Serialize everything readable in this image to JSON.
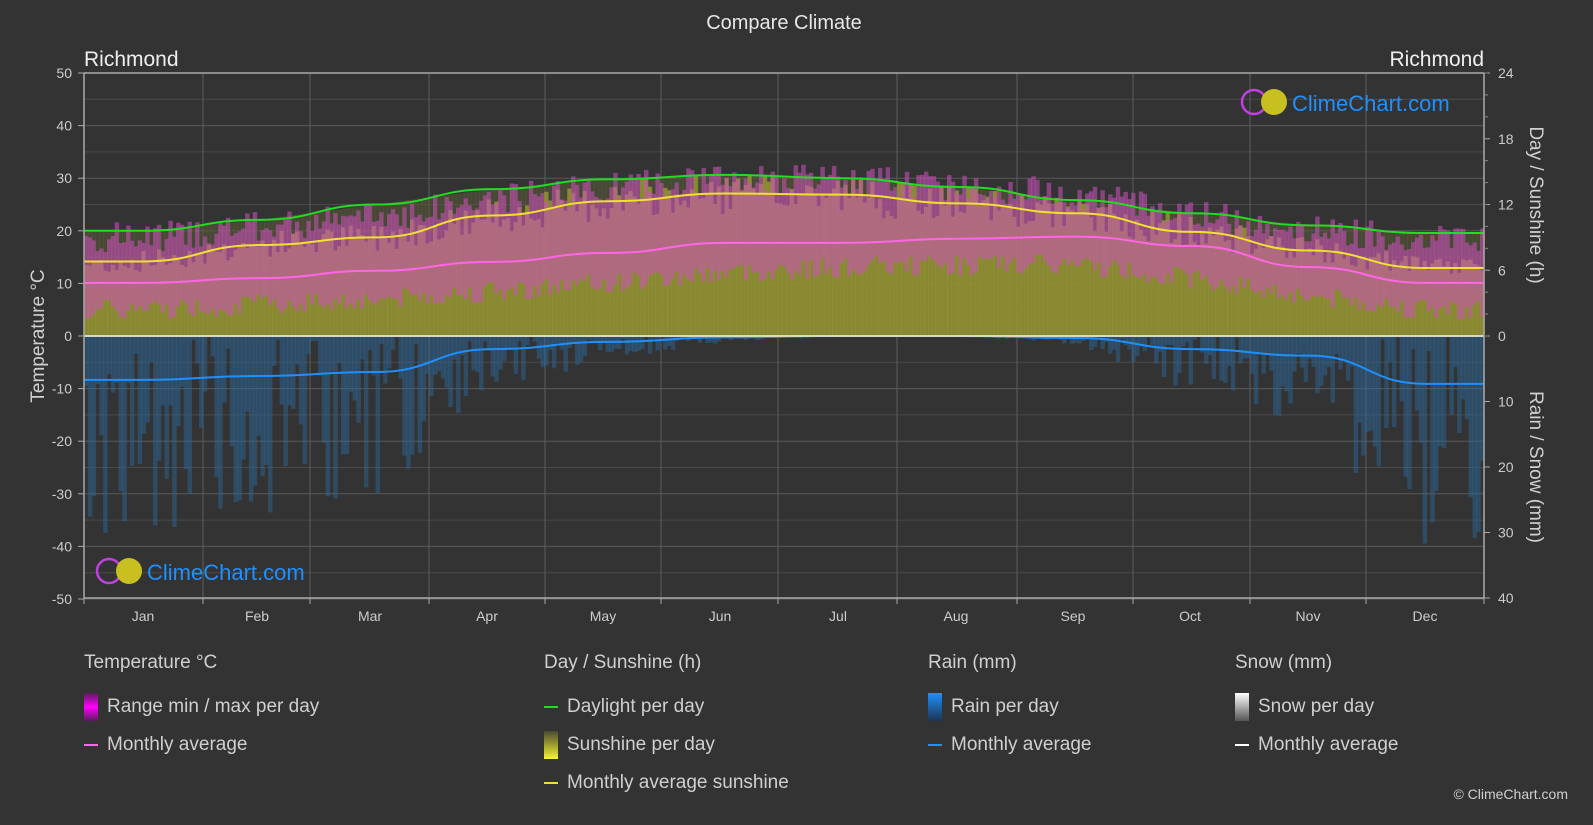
{
  "title": "Compare Climate",
  "location_left": "Richmond",
  "location_right": "Richmond",
  "watermark": "ClimeChart.com",
  "copyright": "© ClimeChart.com",
  "colors": {
    "background": "#333333",
    "temp_range": "#e020e0",
    "temp_avg": "#ff66e6",
    "daylight": "#22dd22",
    "sunshine_fill": "#a8a830",
    "sunshine_avg": "#f0e030",
    "rain": "#2a7abf",
    "rain_avg": "#1e90ff",
    "snow_avg": "#ffffff",
    "logo_blue": "#1e90ff"
  },
  "legend": {
    "temperature": {
      "title": "Temperature °C",
      "items": [
        "Range min / max per day",
        "Monthly average"
      ]
    },
    "sunshine": {
      "title": "Day / Sunshine (h)",
      "items": [
        "Daylight per day",
        "Sunshine per day",
        "Monthly average sunshine"
      ]
    },
    "rain": {
      "title": "Rain (mm)",
      "items": [
        "Rain per day",
        "Monthly average"
      ]
    },
    "snow": {
      "title": "Snow (mm)",
      "items": [
        "Snow per day",
        "Monthly average"
      ]
    }
  },
  "chart_data": {
    "type": "line",
    "title": "Compare Climate",
    "categories": [
      "Jan",
      "Feb",
      "Mar",
      "Apr",
      "May",
      "Jun",
      "Jul",
      "Aug",
      "Sep",
      "Oct",
      "Nov",
      "Dec"
    ],
    "left_axis": {
      "label": "Temperature °C",
      "range": [
        -50,
        50
      ],
      "ticks": [
        50,
        40,
        30,
        20,
        10,
        0,
        -10,
        -20,
        -30,
        -40,
        -50
      ]
    },
    "right_axis_top": {
      "label": "Day / Sunshine (h)",
      "range": [
        0,
        24
      ],
      "ticks": [
        24,
        18,
        12,
        6,
        0
      ]
    },
    "right_axis_bottom": {
      "label": "Rain / Snow (mm)",
      "range": [
        0,
        40
      ],
      "ticks": [
        0,
        10,
        20,
        30,
        40
      ]
    },
    "grid": true,
    "series": [
      {
        "name": "Temperature monthly average",
        "unit": "°C",
        "axis": "temp",
        "values": [
          10.1,
          11.0,
          12.4,
          14.1,
          15.8,
          17.7,
          17.7,
          18.5,
          18.9,
          17.1,
          13.1,
          10.1
        ]
      },
      {
        "name": "Temperature daily max (approx band top)",
        "unit": "°C",
        "axis": "temp",
        "values": [
          17.5,
          19.5,
          21.5,
          24.5,
          27,
          28.5,
          28.5,
          27.5,
          26,
          22,
          19,
          17.5
        ]
      },
      {
        "name": "Temperature daily min (approx band bottom)",
        "unit": "°C",
        "axis": "temp",
        "values": [
          5,
          6,
          7,
          8.5,
          10,
          12,
          13,
          13.5,
          13.5,
          11,
          7.5,
          5
        ]
      },
      {
        "name": "Daylight per day",
        "unit": "h",
        "axis": "sun",
        "values": [
          9.6,
          10.6,
          12.0,
          13.4,
          14.3,
          14.7,
          14.4,
          13.6,
          12.4,
          11.2,
          10.1,
          9.4
        ]
      },
      {
        "name": "Monthly average sunshine",
        "unit": "h",
        "axis": "sun",
        "values": [
          6.8,
          8.3,
          9.0,
          11.0,
          12.3,
          13.0,
          12.9,
          12.1,
          11.2,
          9.5,
          7.8,
          6.2
        ]
      },
      {
        "name": "Rain monthly average",
        "unit": "mm",
        "axis": "rain",
        "values": [
          6.7,
          6.1,
          5.5,
          2.0,
          0.9,
          0.2,
          0.0,
          0.0,
          0.3,
          2.0,
          3.0,
          7.3
        ]
      }
    ]
  }
}
